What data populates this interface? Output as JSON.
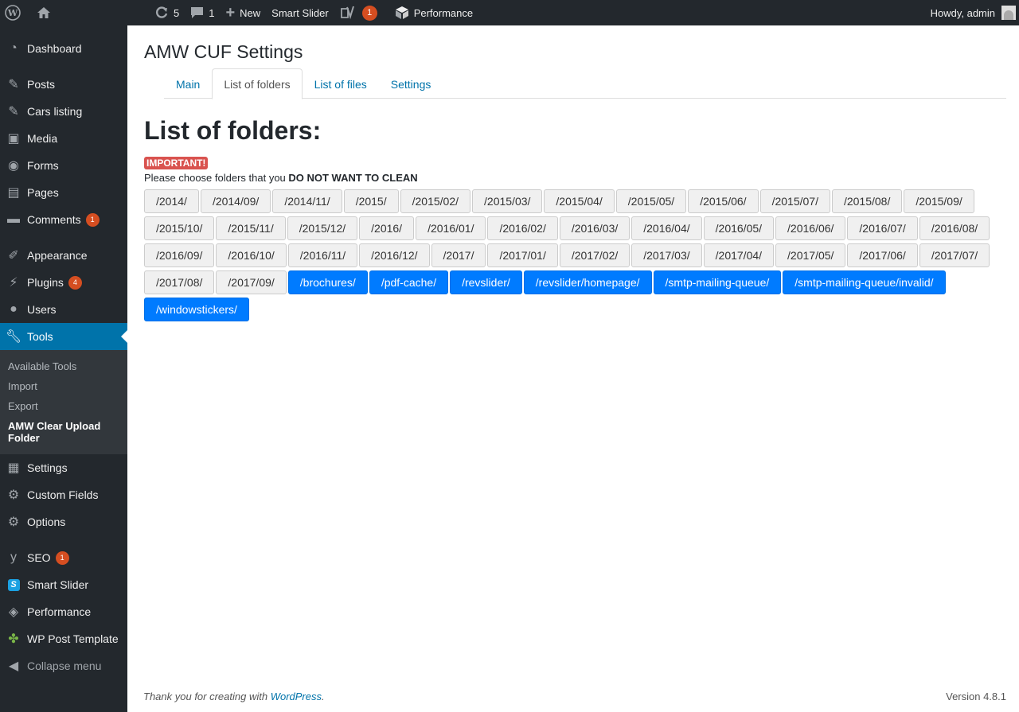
{
  "adminbar": {
    "updates_count": "5",
    "comments_count": "1",
    "new_label": "New",
    "smart_slider_label": "Smart Slider",
    "yoast_badge": "1",
    "performance_label": "Performance",
    "howdy": "Howdy, admin"
  },
  "sidebar": {
    "items": [
      {
        "label": "Dashboard",
        "icon": "dashboard-icon"
      },
      {
        "label": "Posts",
        "icon": "pin-icon"
      },
      {
        "label": "Cars listing",
        "icon": "pin-icon"
      },
      {
        "label": "Media",
        "icon": "media-icon"
      },
      {
        "label": "Forms",
        "icon": "forms-icon"
      },
      {
        "label": "Pages",
        "icon": "pages-icon"
      },
      {
        "label": "Comments",
        "icon": "comment-icon",
        "badge": "1"
      },
      {
        "label": "Appearance",
        "icon": "brush-icon"
      },
      {
        "label": "Plugins",
        "icon": "plug-icon",
        "badge": "4"
      },
      {
        "label": "Users",
        "icon": "user-icon"
      },
      {
        "label": "Tools",
        "icon": "wrench-icon"
      },
      {
        "label": "Settings",
        "icon": "settings-icon"
      },
      {
        "label": "Custom Fields",
        "icon": "gear-icon"
      },
      {
        "label": "Options",
        "icon": "gear-icon"
      },
      {
        "label": "SEO",
        "icon": "yoast-icon",
        "badge": "1"
      },
      {
        "label": "Smart Slider",
        "icon": "smart-slider-icon"
      },
      {
        "label": "Performance",
        "icon": "performance-icon"
      },
      {
        "label": "WP Post Template",
        "icon": "puzzle-icon"
      },
      {
        "label": "Collapse menu",
        "icon": "collapse-icon"
      }
    ],
    "submenu": [
      "Available Tools",
      "Import",
      "Export",
      "AMW Clear Upload Folder"
    ]
  },
  "page": {
    "title": "AMW CUF Settings",
    "tabs": [
      "Main",
      "List of folders",
      "List of files",
      "Settings"
    ],
    "section_title": "List of folders:",
    "important_label": "IMPORTANT!",
    "notice_prefix": "Please choose folders that you ",
    "notice_bold": "DO NOT WANT TO CLEAN"
  },
  "folders": [
    {
      "name": "/2014/",
      "selected": false
    },
    {
      "name": "/2014/09/",
      "selected": false
    },
    {
      "name": "/2014/11/",
      "selected": false
    },
    {
      "name": "/2015/",
      "selected": false
    },
    {
      "name": "/2015/02/",
      "selected": false
    },
    {
      "name": "/2015/03/",
      "selected": false
    },
    {
      "name": "/2015/04/",
      "selected": false
    },
    {
      "name": "/2015/05/",
      "selected": false
    },
    {
      "name": "/2015/06/",
      "selected": false
    },
    {
      "name": "/2015/07/",
      "selected": false
    },
    {
      "name": "/2015/08/",
      "selected": false
    },
    {
      "name": "/2015/09/",
      "selected": false
    },
    {
      "name": "/2015/10/",
      "selected": false
    },
    {
      "name": "/2015/11/",
      "selected": false
    },
    {
      "name": "/2015/12/",
      "selected": false
    },
    {
      "name": "/2016/",
      "selected": false
    },
    {
      "name": "/2016/01/",
      "selected": false
    },
    {
      "name": "/2016/02/",
      "selected": false
    },
    {
      "name": "/2016/03/",
      "selected": false
    },
    {
      "name": "/2016/04/",
      "selected": false
    },
    {
      "name": "/2016/05/",
      "selected": false
    },
    {
      "name": "/2016/06/",
      "selected": false
    },
    {
      "name": "/2016/07/",
      "selected": false
    },
    {
      "name": "/2016/08/",
      "selected": false
    },
    {
      "name": "/2016/09/",
      "selected": false
    },
    {
      "name": "/2016/10/",
      "selected": false
    },
    {
      "name": "/2016/11/",
      "selected": false
    },
    {
      "name": "/2016/12/",
      "selected": false
    },
    {
      "name": "/2017/",
      "selected": false
    },
    {
      "name": "/2017/01/",
      "selected": false
    },
    {
      "name": "/2017/02/",
      "selected": false
    },
    {
      "name": "/2017/03/",
      "selected": false
    },
    {
      "name": "/2017/04/",
      "selected": false
    },
    {
      "name": "/2017/05/",
      "selected": false
    },
    {
      "name": "/2017/06/",
      "selected": false
    },
    {
      "name": "/2017/07/",
      "selected": false
    },
    {
      "name": "/2017/08/",
      "selected": false
    },
    {
      "name": "/2017/09/",
      "selected": false
    },
    {
      "name": "/brochures/",
      "selected": true
    },
    {
      "name": "/pdf-cache/",
      "selected": true
    },
    {
      "name": "/revslider/",
      "selected": true
    },
    {
      "name": "/revslider/homepage/",
      "selected": true
    },
    {
      "name": "/smtp-mailing-queue/",
      "selected": true
    },
    {
      "name": "/smtp-mailing-queue/invalid/",
      "selected": true
    },
    {
      "name": "/windowstickers/",
      "selected": true
    }
  ],
  "footer": {
    "thanks_prefix": "Thank you for creating with ",
    "wordpress_link": "WordPress",
    "thanks_suffix": ".",
    "version": "Version 4.8.1"
  },
  "colors": {
    "admin_dark": "#23282d",
    "active_blue": "#0073aa",
    "selected_folder": "#007bff",
    "badge": "#d54e21",
    "important": "#d9534f"
  }
}
